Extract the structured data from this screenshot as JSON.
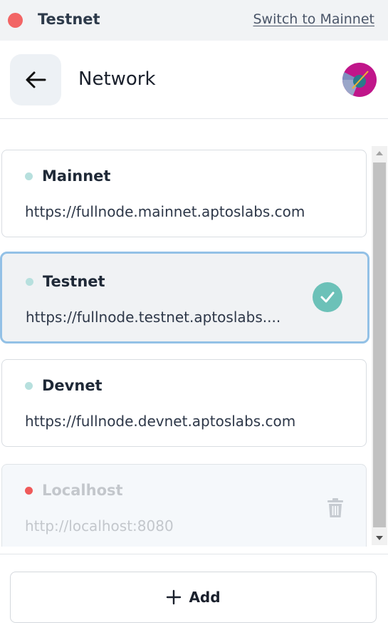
{
  "topbar": {
    "network_name": "Testnet",
    "switch_label": "Switch to Mainnet",
    "status_color": "#f26565"
  },
  "header": {
    "title": "Network",
    "back_icon": "arrow-left-icon"
  },
  "networks": [
    {
      "name": "Mainnet",
      "url": "https://fullnode.mainnet.aptoslabs.com",
      "selected": false,
      "status_color": "#b7e0de"
    },
    {
      "name": "Testnet",
      "url": "https://fullnode.testnet.aptoslabs....",
      "selected": true,
      "status_color": "#b7e0de"
    },
    {
      "name": "Devnet",
      "url": "https://fullnode.devnet.aptoslabs.com",
      "selected": false,
      "status_color": "#b7e0de"
    },
    {
      "name": "Localhost",
      "url": "http://localhost:8080",
      "selected": false,
      "disabled": true,
      "status_color": "#ef5a5a"
    }
  ],
  "footer": {
    "add_label": "Add",
    "add_icon": "plus-icon"
  },
  "colors": {
    "selected_border": "#93c1e6",
    "check": "#6cc1b8"
  }
}
